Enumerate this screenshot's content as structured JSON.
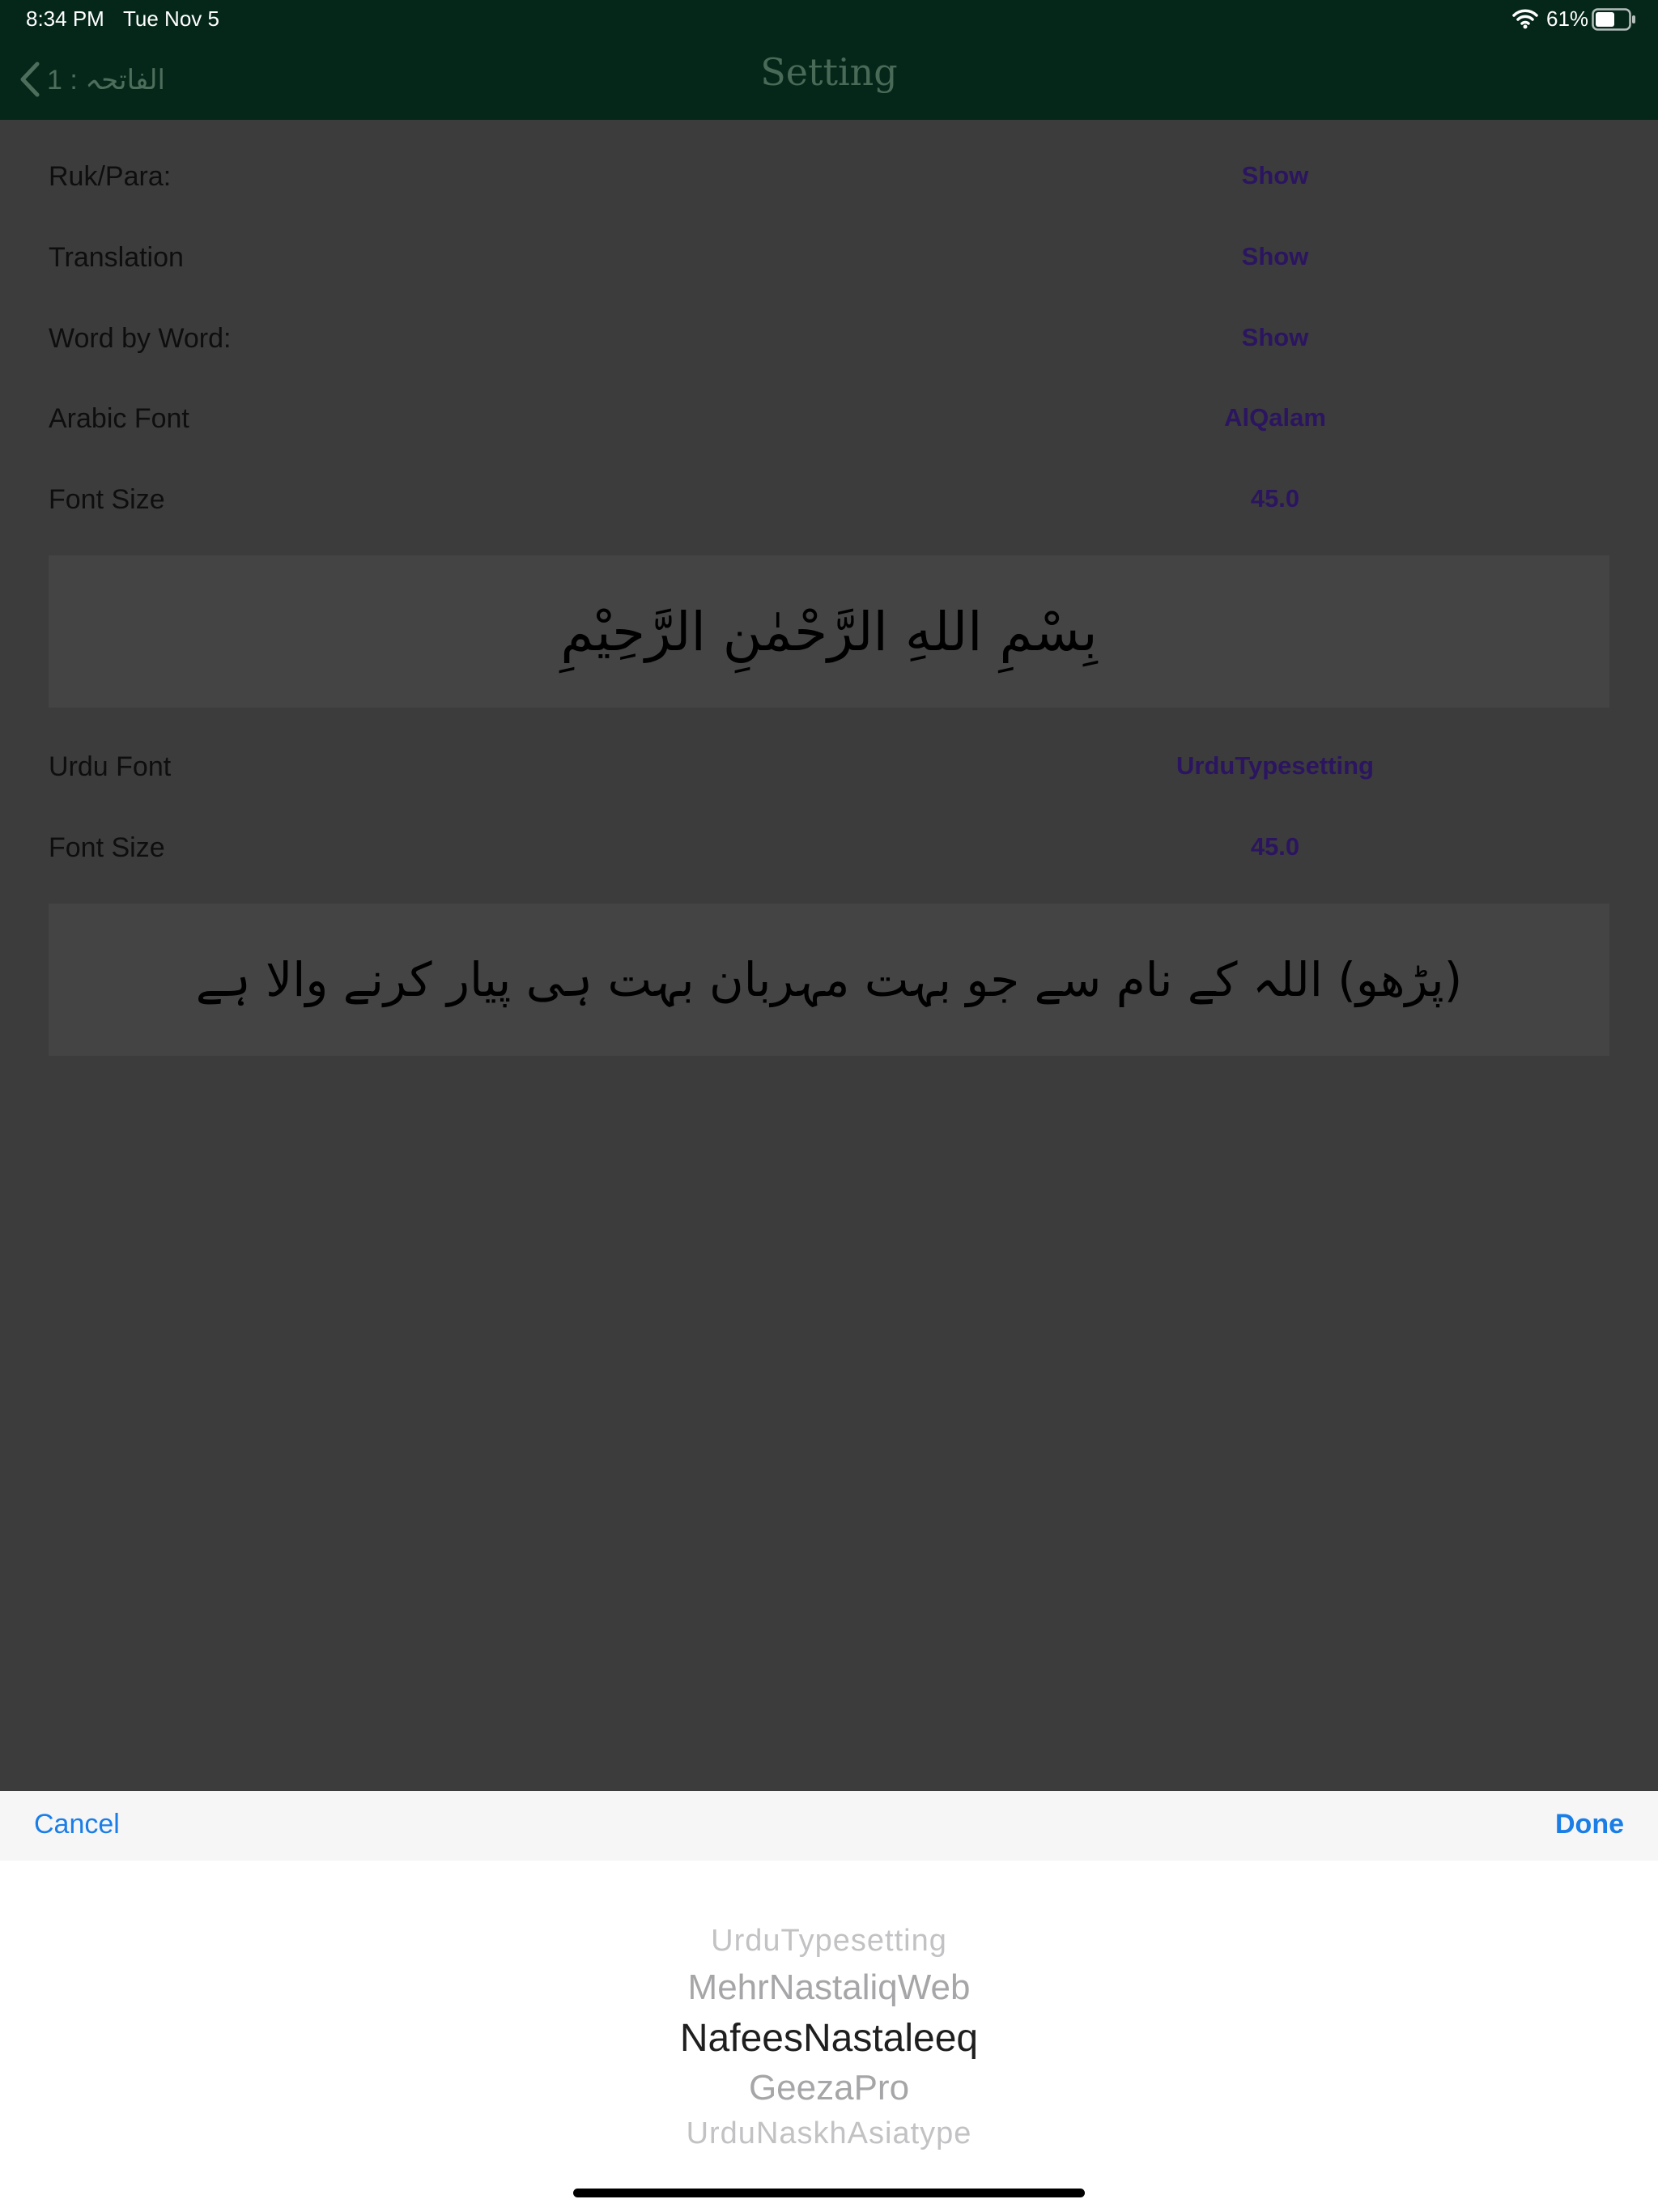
{
  "status": {
    "time": "8:34 PM",
    "date": "Tue Nov 5",
    "battery": "61%"
  },
  "nav": {
    "back_label": "الفاتحہ : 1",
    "title": "Setting"
  },
  "settings": [
    {
      "label": "Ruk/Para:",
      "value": "Show"
    },
    {
      "label": "Translation",
      "value": "Show"
    },
    {
      "label": "Word by Word:",
      "value": "Show"
    },
    {
      "label": "Arabic Font",
      "value": "AlQalam"
    },
    {
      "label": "Font Size",
      "value": "45.0"
    }
  ],
  "arabic_preview": "بِسْمِ اللهِ الرَّحْمٰنِ الرَّحِيْمِ",
  "urdu_settings": [
    {
      "label": "Urdu Font",
      "value": "UrduTypesetting"
    },
    {
      "label": "Font Size",
      "value": "45.0"
    }
  ],
  "urdu_preview": "(پڑھو) اللہ کے نام سے جو بہت مہربان بہت ہی پیار کرنے والا ہے",
  "toolbar": {
    "cancel": "Cancel",
    "done": "Done"
  },
  "picker": {
    "options": [
      "UrduTypesetting",
      "MehrNastaliqWeb",
      "NafeesNastaleeq",
      "GeezaPro",
      "UrduNaskhAsiatype"
    ],
    "selected": "NafeesNastaleeq"
  },
  "colors": {
    "nav_bar": "#05271a",
    "accent": "#1a7ee6",
    "value_text": "#2b1560"
  }
}
